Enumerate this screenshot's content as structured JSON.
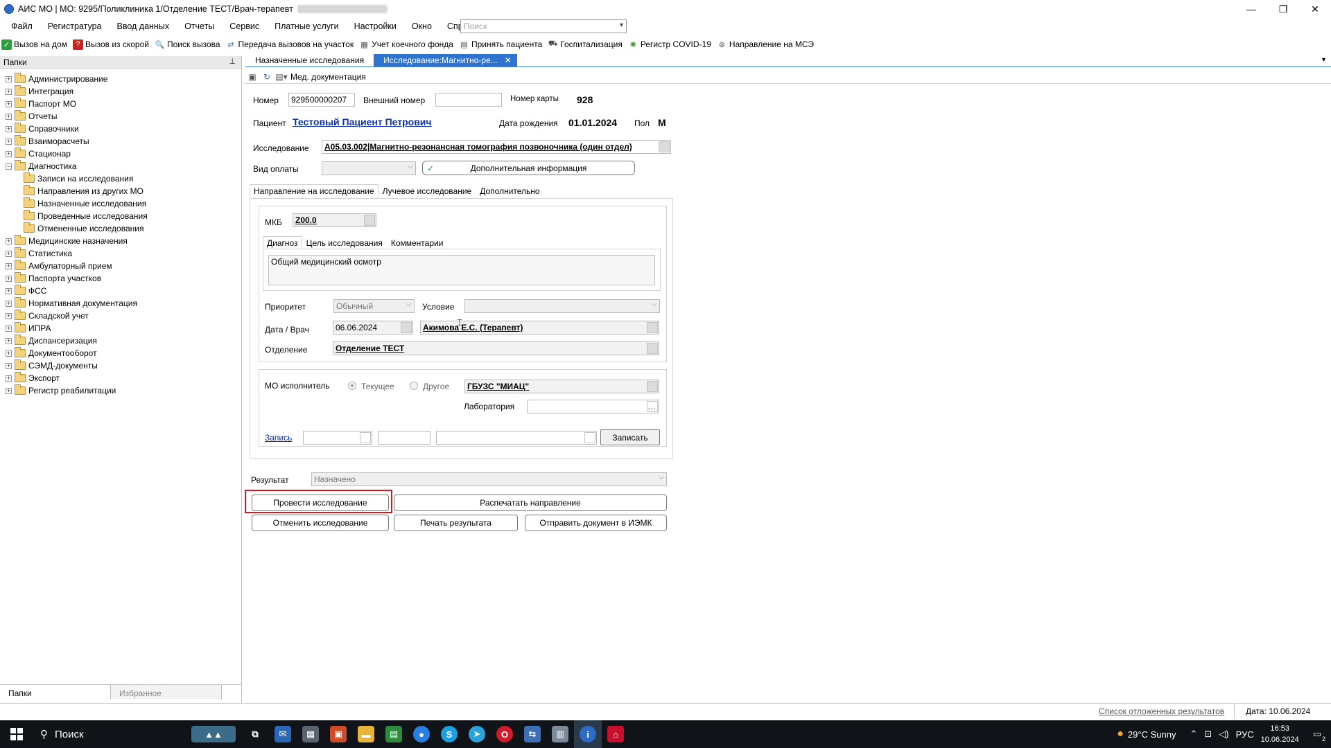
{
  "window": {
    "title": "АИС МО | МО: 9295/Поликлиника 1/Отделение ТЕСТ/Врач-терапевт",
    "minimize": "—",
    "maximize": "❐",
    "close": "✕"
  },
  "menu": [
    "Файл",
    "Регистратура",
    "Ввод данных",
    "Отчеты",
    "Сервис",
    "Платные услуги",
    "Настройки",
    "Окно",
    "Справка"
  ],
  "search": {
    "placeholder": "Поиск"
  },
  "toolbar": [
    {
      "label": "Вызов на дом",
      "icon": "house-check-icon",
      "color": "#2e9e3b"
    },
    {
      "label": "Вызов из скорой",
      "icon": "ambulance-icon",
      "color": "#d02020"
    },
    {
      "label": "Поиск вызова",
      "icon": "search-call-icon",
      "color": "#2d5fb0"
    },
    {
      "label": "Передача вызовов на участок",
      "icon": "transfer-icon",
      "color": "#3a6fb8"
    },
    {
      "label": "Учет коечного фонда",
      "icon": "bed-icon",
      "color": "#555555"
    },
    {
      "label": "Принять пациента",
      "icon": "patient-icon",
      "color": "#555555"
    },
    {
      "label": "Госпитализация",
      "icon": "hospital-icon",
      "color": "#555555"
    },
    {
      "label": "Регистр COVID-19",
      "icon": "virus-icon",
      "color": "#3a9a3a"
    },
    {
      "label": "Направление на МСЭ",
      "icon": "referral-icon",
      "color": "#555555"
    }
  ],
  "left_panel": {
    "header": "Папки",
    "tree": [
      {
        "label": "Администрирование",
        "expanded": false,
        "child": false
      },
      {
        "label": "Интеграция",
        "expanded": false,
        "child": false
      },
      {
        "label": "Паспорт МО",
        "expanded": false,
        "child": false
      },
      {
        "label": "Отчеты",
        "expanded": false,
        "child": false
      },
      {
        "label": "Справочники",
        "expanded": false,
        "child": false
      },
      {
        "label": "Взаиморасчеты",
        "expanded": false,
        "child": false
      },
      {
        "label": "Стационар",
        "expanded": false,
        "child": false
      },
      {
        "label": "Диагностика",
        "expanded": true,
        "child": false
      },
      {
        "label": "Записи на исследования",
        "expanded": null,
        "child": true
      },
      {
        "label": "Направления из других МО",
        "expanded": null,
        "child": true
      },
      {
        "label": "Назначенные исследования",
        "expanded": null,
        "child": true
      },
      {
        "label": "Проведенные исследования",
        "expanded": null,
        "child": true
      },
      {
        "label": "Отмененные исследования",
        "expanded": null,
        "child": true
      },
      {
        "label": "Медицинские назначения",
        "expanded": false,
        "child": false
      },
      {
        "label": "Статистика",
        "expanded": false,
        "child": false
      },
      {
        "label": "Амбулаторный прием",
        "expanded": false,
        "child": false
      },
      {
        "label": "Паспорта участков",
        "expanded": false,
        "child": false
      },
      {
        "label": "ФСС",
        "expanded": false,
        "child": false
      },
      {
        "label": "Нормативная документация",
        "expanded": null,
        "child": false
      },
      {
        "label": "Складской учет",
        "expanded": false,
        "child": false
      },
      {
        "label": "ИПРА",
        "expanded": false,
        "child": false
      },
      {
        "label": "Диспансеризация",
        "expanded": false,
        "child": false
      },
      {
        "label": "Документооборот",
        "expanded": false,
        "child": false
      },
      {
        "label": "СЭМД-документы",
        "expanded": false,
        "child": false
      },
      {
        "label": "Экспорт",
        "expanded": false,
        "child": false
      },
      {
        "label": "Регистр реабилитации",
        "expanded": false,
        "child": false
      }
    ],
    "bottom_tabs": [
      "Папки",
      "Избранное"
    ]
  },
  "doc_tabs": [
    "Назначенные исследования",
    "Исследование:Магнитно-ре..."
  ],
  "subtoolbar": {
    "label": "Мед. документация"
  },
  "form": {
    "number_label": "Номер",
    "number_value": "929500000207",
    "ext_number_label": "Внешний номер",
    "ext_number_value": "",
    "card_label": "Номер карты",
    "card_value": "928",
    "patient_label": "Пациент",
    "patient_value": "Тестовый Пациент Петрович",
    "dob_label": "Дата рождения",
    "dob_value": "01.01.2024",
    "sex_label": "Пол",
    "sex_value": "М",
    "study_label": "Исследование",
    "study_value": "A05.03.002|Магнитно-резонансная томография позвоночника (один отдел)",
    "payment_label": "Вид оплаты",
    "payment_value": "",
    "extra_info_button": "Дополнительная информация",
    "tabs": [
      "Направление на исследование",
      "Лучевое исследование",
      "Дополнительно"
    ],
    "mkb_label": "МКБ",
    "mkb_value": "Z00.0",
    "inner_tabs": [
      "Диагноз",
      "Цель исследования",
      "Комментарии"
    ],
    "diagnosis_text": "Общий медицинский осмотр",
    "priority_label": "Приоритет",
    "priority_value": "Обычный",
    "condition_label": "Условие",
    "condition_value": "",
    "date_doctor_label": "Дата / Врач",
    "date_value": "06.06.2024",
    "doctor_value": "Акимова Е.С. (Терапевт)",
    "department_label": "Отделение",
    "department_value": "Отделение ТЕСТ",
    "mo_label": "МО исполнитель",
    "mo_current": "Текущее",
    "mo_other": "Другое",
    "mo_value": "ГБУЗС \"МИАЦ\"",
    "lab_label": "Лаборатория",
    "lab_value": "",
    "record_link": "Запись",
    "record_button": "Записать",
    "result_label": "Результат",
    "result_value": "Назначено"
  },
  "actions": {
    "conduct": "Провести исследование",
    "print_referral": "Распечатать направление",
    "cancel": "Отменить исследование",
    "print_result": "Печать результата",
    "send_iemk": "Отправить документ в ИЭМК"
  },
  "statusbar": {
    "deferred": "Список отложенных результатов",
    "date": "Дата: 10.06.2024"
  },
  "taskbar": {
    "search": "Поиск",
    "weather": "29°C  Sunny",
    "lang": "РУС",
    "time": "16:53",
    "date": "10.06.2024",
    "notifications": "2"
  }
}
